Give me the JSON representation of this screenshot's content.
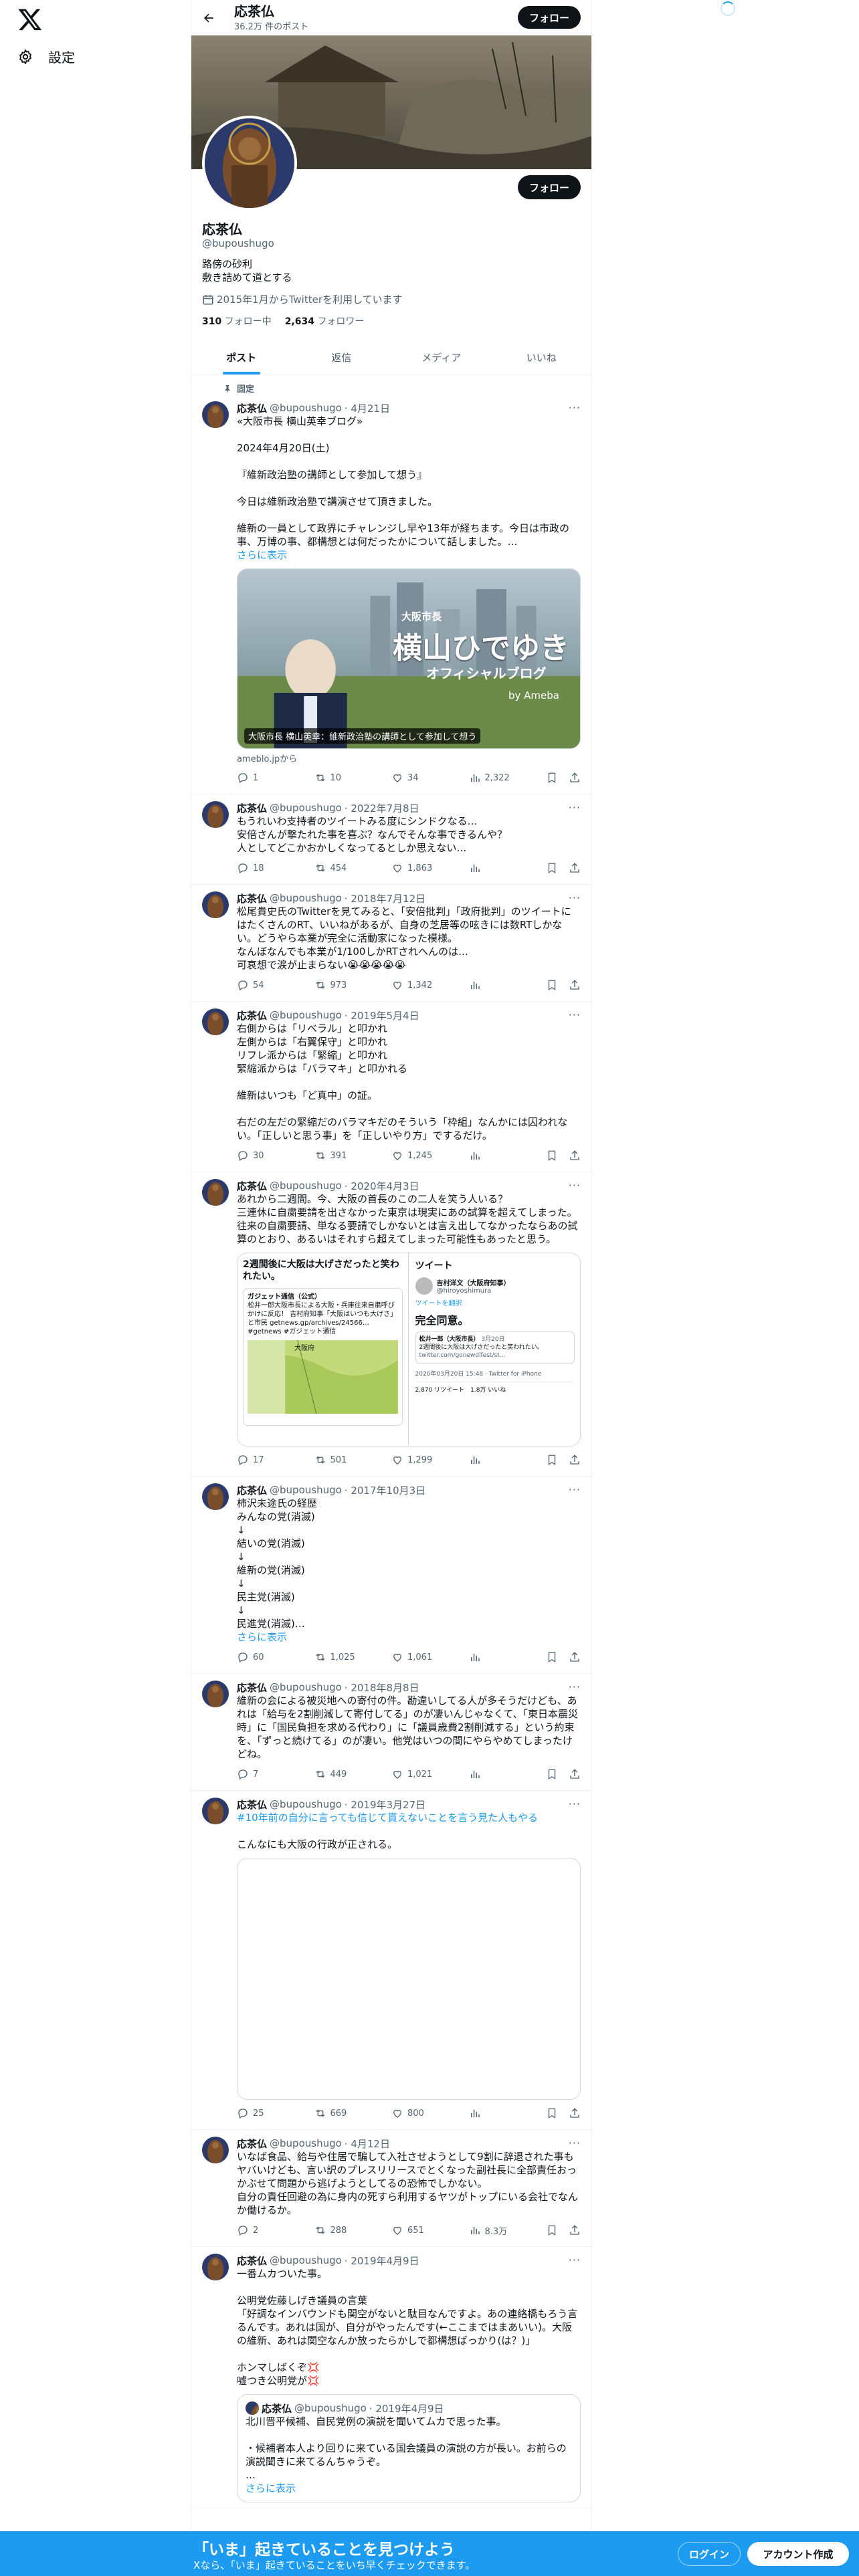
{
  "nav": {
    "settings": "設定"
  },
  "topbar": {
    "name": "応茶仏",
    "count": "36.2万 件のポスト",
    "follow": "フォロー"
  },
  "profile": {
    "name": "応茶仏",
    "handle": "@bupoushugo",
    "bio1": "路傍の砂利",
    "bio2": "敷き詰めて道とする",
    "joined": "2015年1月からTwitterを利用しています",
    "following_count": "310",
    "following_label": "フォロー中",
    "followers_count": "2,634",
    "followers_label": "フォロワー",
    "follow": "フォロー"
  },
  "tabs": [
    "ポスト",
    "返信",
    "メディア",
    "いいね"
  ],
  "pinned_label": "固定",
  "tweets": [
    {
      "name": "応茶仏",
      "handle": "@bupoushugo",
      "date": "· 4月21日",
      "text": "«大阪市長 横山英幸ブログ»\n\n2024年4月20日(土)\n\n『維新政治塾の講師として参加して想う』\n\n今日は維新政治塾で講演させて頂きました。\n\n維新の一員として政界にチャレンジし早や13年が経ちます。今日は市政の事、万博の事、都構想とは何だったかについて話しました。…",
      "show_more": "さらに表示",
      "card": {
        "line1": "大阪市長",
        "line2": "横山ひでゆき",
        "line3": "オフィシャルブログ",
        "by": "by Ameba",
        "caption": "大阪市長 横山英幸：維新政治塾の講師として参加して想う",
        "source": "ameblo.jpから"
      },
      "replies": "1",
      "retweets": "10",
      "likes": "34",
      "views": "2,322"
    },
    {
      "name": "応茶仏",
      "handle": "@bupoushugo",
      "date": "· 2022年7月8日",
      "text": "もうれいわ支持者のツイートみる度にシンドクなる…\n安倍さんが撃たれた事を喜ぶ？なんでそんな事できるんや？\n人としてどこかおかしくなってるとしか思えない…",
      "replies": "18",
      "retweets": "454",
      "likes": "1,863",
      "views": ""
    },
    {
      "name": "応茶仏",
      "handle": "@bupoushugo",
      "date": "· 2018年7月12日",
      "text": "松尾貴史氏のTwitterを見てみると、「安倍批判」「政府批判」のツイートにはたくさんのRT、いいねがあるが、自身の芝居等の呟きには数RTしかない。どうやら本業が完全に活動家になった模様。\nなんぼなんでも本業が1/100しかRTされへんのは…\n可哀想で涙が止まらない😭😭😭😭😭",
      "replies": "54",
      "retweets": "973",
      "likes": "1,342",
      "views": ""
    },
    {
      "name": "応茶仏",
      "handle": "@bupoushugo",
      "date": "· 2019年5月4日",
      "text": "右側からは「リベラル」と叩かれ\n左側からは「右翼保守」と叩かれ\nリフレ派からは「緊縮」と叩かれ\n緊縮派からは「バラマキ」と叩かれる\n\n維新はいつも「ど真中」の証。\n\n右だの左だの緊縮だのバラマキだのそういう「枠組」なんかには囚われない。「正しいと思う事」を「正しいやり方」でするだけ。",
      "replies": "30",
      "retweets": "391",
      "likes": "1,245",
      "views": ""
    },
    {
      "name": "応茶仏",
      "handle": "@bupoushugo",
      "date": "· 2020年4月3日",
      "text": "あれから二週間。今、大阪の首長のこの二人を笑う人いる？\n三連休に自粛要請を出さなかった東京は現実にあの試算を超えてしまった。\n往来の自粛要請、単なる要請でしかないとは言え出してなかったならあの試算のとおり、あるいはそれすら超えてしまった可能性もあったと思う。",
      "img_left": {
        "top": "2週間後に大阪は大げさだったと笑われたい。",
        "site": "ガジェット通信（公式）",
        "body": "松井一郎大阪市長による大阪・兵庫往来自粛呼びかけに反応！ 吉村府知事「大阪はいつも大げさ」と市民 getnews.gp/archives/24566… #getnews #ガジェット通信",
        "date": "3月20日",
        "map": "大阪府"
      },
      "img_right": {
        "title": "ツイート",
        "name": "吉村洋文（大阪府知事）",
        "handle": "@hiroyoshimura",
        "translate": "ツイートを翻訳",
        "main": "完全同意。",
        "inner_name": "松井一郎（大阪市長）",
        "inner_date": "3月20日",
        "inner_text": "2週間後に大阪は大げさだったと笑われたい。",
        "link": "twitter.com/gonewdlfest/st…",
        "meta": "2020年03月20日 15:48 · Twitter for iPhone",
        "stats": "2,870 リツイート　1.8万 いいね"
      },
      "replies": "17",
      "retweets": "501",
      "likes": "1,299",
      "views": ""
    },
    {
      "name": "応茶仏",
      "handle": "@bupoushugo",
      "date": "· 2017年10月3日",
      "text": "柿沢未途氏の経歴\nみんなの党(消滅)\n↓\n結いの党(消滅)\n↓\n維新の党(消滅)\n↓\n民主党(消滅)\n↓\n民進党(消滅)…",
      "show_more": "さらに表示",
      "replies": "60",
      "retweets": "1,025",
      "likes": "1,061",
      "views": ""
    },
    {
      "name": "応茶仏",
      "handle": "@bupoushugo",
      "date": "· 2018年8月8日",
      "text": "維新の会による被災地への寄付の件。勘違いしてる人が多そうだけども、あれは「給与を2割削減して寄付してる」のが凄いんじゃなくて、「東日本震災時」に「国民負担を求める代わり」に「議員歳費2割削減する」という約束を、「ずっと続けてる」のが凄い。他党はいつの間にやらやめてしまったけどね。",
      "replies": "7",
      "retweets": "449",
      "likes": "1,021",
      "views": ""
    },
    {
      "name": "応茶仏",
      "handle": "@bupoushugo",
      "date": "· 2019年3月27日",
      "hashtag": "#10年前の自分に言っても信じて貰えないことを言う見た人もやる",
      "text": "こんなにも大阪の行政が正される。",
      "replies": "25",
      "retweets": "669",
      "likes": "800",
      "views": ""
    },
    {
      "name": "応茶仏",
      "handle": "@bupoushugo",
      "date": "· 4月12日",
      "text": "いなば食品、給与や住居で騙して入社させようとして9割に辞退された事もヤバいけども、言い訳のプレスリリースでとくなった副社長に全部責任おっかぶせて問題から逃げようとしてるの恐怖でしかない。\n自分の責任回避の為に身内の死すら利用するヤツがトップにいる会社でなんか働けるか。",
      "replies": "2",
      "retweets": "288",
      "likes": "651",
      "views": "8.3万"
    },
    {
      "name": "応茶仏",
      "handle": "@bupoushugo",
      "date": "· 2019年4月9日",
      "text": "一番ムカついた事。\n\n公明党佐藤しげき議員の言葉\n「好調なインバウンドも関空がないと駄目なんですよ。あの連絡橋もろう言るんです。あれは国が、自分がやったんです(←ここまではまあいい)。大阪の維新、あれは関空なんか放ったらかしで都構想ばっかり(は？)」\n\nホンマしばくぞ💢\n嘘つき公明党が💢",
      "quote": {
        "name": "応茶仏",
        "handle": "@bupoushugo",
        "date": "· 2019年4月9日",
        "text": "北川晋平候補、自民党例の演説を聞いてムカで思った事。\n\n・候補者本人より回りに来ている国会議員の演説の方が長い。お前らの演説聞きに来てるんちゃうぞ。\n…",
        "show_more": "さらに表示"
      },
      "replies": "",
      "retweets": "",
      "likes": "",
      "views": ""
    }
  ],
  "bottom": {
    "title": "「いま」起きていることを見つけよう",
    "sub": "Xなら、「いま」起きていることをいち早くチェックできます。",
    "login": "ログイン",
    "signup": "アカウント作成"
  }
}
